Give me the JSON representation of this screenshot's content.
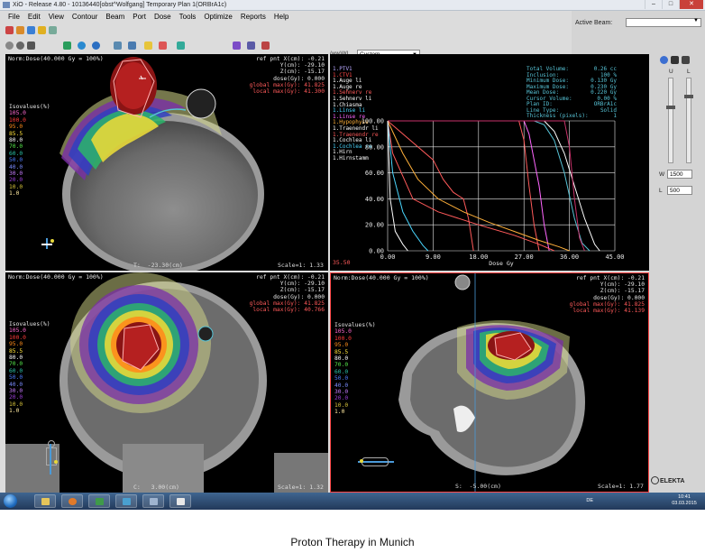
{
  "window": {
    "title": "XiO - Release 4.80 - 10136440[obst^Wolfgang] Temporary Plan 1(ORBrA1c)",
    "controls": {
      "minimize": "–",
      "maximize": "□",
      "close": "✕"
    }
  },
  "menu": [
    "File",
    "Edit",
    "View",
    "Contour",
    "Beam",
    "Port",
    "Dose",
    "Tools",
    "Optimize",
    "Reports",
    "Help"
  ],
  "toolbar": {
    "wl_label": "(ww)WL",
    "wl_preset": "Custom",
    "icons": [
      "zoom-icon",
      "pan-icon",
      "window-level-icon",
      "contour-icon",
      "grid-icon",
      "dose-icon",
      "beam-icon",
      "sphere-icon",
      "sphere-icon",
      "ruler-icon",
      "flag-icon",
      "undo-icon"
    ]
  },
  "right_pane": {
    "active_beam_label": "Active Beam:",
    "active_beam_value": "",
    "slider_u_label": "U",
    "slider_l_label": "L",
    "w_label": "W",
    "w_value": "1500",
    "l_label": "L",
    "l_value": "500",
    "brand": "ELEKTA"
  },
  "views": {
    "transverse": {
      "norm": "Norm:Dose(40.000 Gy = 100%)",
      "ref_labels": [
        "ref pnt X(cm):",
        "Y(cm):",
        "Z(cm):",
        "dose(Gy):",
        "global max(Gy):",
        "local max(Gy):"
      ],
      "ref_values": [
        "-0.21",
        "-29.10",
        "-15.17",
        "0.000",
        "41.825",
        "41.300"
      ],
      "slice": "T:  -23.30(cm)",
      "scale": "Scale=1: 1.33"
    },
    "coronal": {
      "norm": "Norm:Dose(40.000 Gy = 100%)",
      "ref_labels": [
        "ref pnt X(cm):",
        "Y(cm):",
        "Z(cm):",
        "dose(Gy):",
        "global max(Gy):",
        "local max(Gy):"
      ],
      "ref_values": [
        "-0.21",
        "-29.10",
        "-15.17",
        "0.000",
        "41.825",
        "40.766"
      ],
      "slice": "C:   3.00(cm)",
      "scale": "Scale=1: 1.32"
    },
    "sagittal": {
      "norm": "Norm:Dose(40.000 Gy = 100%)",
      "ref_labels": [
        "ref pnt X(cm):",
        "Y(cm):",
        "Z(cm):",
        "dose(Gy):",
        "global max(Gy):",
        "local max(Gy):"
      ],
      "ref_values": [
        "-0.21",
        "-29.10",
        "-15.17",
        "0.000",
        "41.825",
        "41.139"
      ],
      "slice": "S:  -5.00(cm)",
      "scale": "Scale=1: 1.77"
    }
  },
  "isovalues": {
    "title": "Isovalues(%)",
    "levels": [
      {
        "v": "105.0",
        "c": "#ff6ad1"
      },
      {
        "v": "100.0",
        "c": "#ff3b3b"
      },
      {
        "v": "95.0",
        "c": "#ff8c1a"
      },
      {
        "v": "85.5",
        "c": "#ffe23a"
      },
      {
        "v": "80.0",
        "c": "#ffffff"
      },
      {
        "v": "70.0",
        "c": "#55e84a"
      },
      {
        "v": "60.0",
        "c": "#2bc3a8"
      },
      {
        "v": "50.0",
        "c": "#4c7dff"
      },
      {
        "v": "40.0",
        "c": "#7a8cff"
      },
      {
        "v": "30.0",
        "c": "#c77dff"
      },
      {
        "v": "20.0",
        "c": "#9b3fd9"
      },
      {
        "v": "10.0",
        "c": "#d6c23a"
      },
      {
        "v": "1.0",
        "c": "#ffe9a0"
      }
    ]
  },
  "dvh": {
    "structures": [
      {
        "name": "1.PTV1",
        "c": "#b8a8ff"
      },
      {
        "name": "1.CTV1",
        "c": "#ff4a4a"
      },
      {
        "name": "1.Auge li",
        "c": "#ffffff"
      },
      {
        "name": "1.Auge re",
        "c": "#ffffff"
      },
      {
        "name": "1.Sehnerv re",
        "c": "#ff5a5a"
      },
      {
        "name": "1.Sehnerv li",
        "c": "#ffffff"
      },
      {
        "name": "1.Chiasma",
        "c": "#ffffff"
      },
      {
        "name": "1.Linse li",
        "c": "#4ad7ff"
      },
      {
        "name": "1.Linse re",
        "c": "#ff66ff"
      },
      {
        "name": "1.Hypophyse",
        "c": "#ffb03a"
      },
      {
        "name": "1.Traenendr li",
        "c": "#ffffff"
      },
      {
        "name": "1.Traenendr re",
        "c": "#ff5a5a"
      },
      {
        "name": "1.Cochlea li",
        "c": "#ffffff"
      },
      {
        "name": "1.Cochlea re",
        "c": "#4ad7ff"
      },
      {
        "name": "1.Hirn",
        "c": "#ffffff"
      },
      {
        "name": "1.Hirnstamm",
        "c": "#ffffff"
      }
    ],
    "info": [
      {
        "k": "Total Volume:",
        "v": "0.26 cc"
      },
      {
        "k": "Inclusion:",
        "v": "100 %"
      },
      {
        "k": "Minimum Dose:",
        "v": "0.130 Gy"
      },
      {
        "k": "Maximum Dose:",
        "v": "0.230 Gy"
      },
      {
        "k": "Mean Dose:",
        "v": "0.220 Gy"
      },
      {
        "k": "Cursor Volume:",
        "v": "0.00 %"
      },
      {
        "k": "Plan ID:",
        "v": "ORBrA1c"
      },
      {
        "k": "Line Type:",
        "v": "Solid"
      },
      {
        "k": "Thickness (pixels):",
        "v": "1"
      }
    ],
    "y_ticks": [
      "100.00",
      "80.00",
      "60.00",
      "40.00",
      "20.00",
      "0.00"
    ],
    "x_ticks": [
      "0.00",
      "9.00",
      "18.00",
      "27.00",
      "36.00",
      "45.00"
    ],
    "x_label": "Dose Gy",
    "cursor": "35.50"
  },
  "chart_data": {
    "type": "line",
    "xlabel": "Dose Gy",
    "ylabel": "",
    "xlim": [
      0,
      45
    ],
    "ylim": [
      0,
      100
    ],
    "grid": true,
    "series": [
      {
        "color": "#57c3d6",
        "points": [
          [
            0,
            100
          ],
          [
            29,
            100
          ],
          [
            31,
            97
          ],
          [
            33,
            85
          ],
          [
            35,
            60
          ],
          [
            37,
            25
          ],
          [
            38.5,
            6
          ],
          [
            40,
            0
          ]
        ]
      },
      {
        "color": "#ffffff",
        "points": [
          [
            0,
            100
          ],
          [
            31,
            100
          ],
          [
            33,
            92
          ],
          [
            35,
            75
          ],
          [
            37,
            50
          ],
          [
            39,
            25
          ],
          [
            41,
            5
          ],
          [
            42,
            0
          ]
        ]
      },
      {
        "color": "#ff66ff",
        "points": [
          [
            0,
            100
          ],
          [
            27,
            100
          ],
          [
            28,
            90
          ],
          [
            29,
            70
          ],
          [
            30,
            50
          ],
          [
            31,
            20
          ],
          [
            32,
            0
          ]
        ]
      },
      {
        "color": "#ff5a5a",
        "points": [
          [
            0,
            100
          ],
          [
            26,
            100
          ],
          [
            27,
            85
          ],
          [
            28,
            50
          ],
          [
            29,
            20
          ],
          [
            30,
            0
          ]
        ]
      },
      {
        "color": "#c8326a",
        "points": [
          [
            0,
            100
          ],
          [
            35,
            100
          ],
          [
            36,
            80
          ],
          [
            37,
            40
          ],
          [
            38,
            10
          ],
          [
            39,
            0
          ]
        ]
      },
      {
        "color": "#ff5a5a",
        "points": [
          [
            0,
            100
          ],
          [
            9,
            70
          ],
          [
            11,
            55
          ],
          [
            13,
            45
          ],
          [
            15,
            40
          ],
          [
            16,
            25
          ],
          [
            17,
            0
          ]
        ]
      },
      {
        "color": "#ffb03a",
        "points": [
          [
            0,
            100
          ],
          [
            3,
            75
          ],
          [
            6,
            55
          ],
          [
            10,
            40
          ],
          [
            15,
            30
          ],
          [
            20,
            22
          ],
          [
            25,
            15
          ],
          [
            30,
            8
          ],
          [
            34,
            3
          ],
          [
            36,
            0
          ]
        ]
      },
      {
        "color": "#ff5a5a",
        "points": [
          [
            0,
            100
          ],
          [
            1,
            75
          ],
          [
            5,
            40
          ],
          [
            10,
            30
          ],
          [
            18,
            20
          ],
          [
            25,
            12
          ],
          [
            30,
            5
          ],
          [
            33,
            0
          ]
        ]
      },
      {
        "color": "#4ad7ff",
        "points": [
          [
            0,
            100
          ],
          [
            1,
            60
          ],
          [
            3,
            30
          ],
          [
            5,
            15
          ],
          [
            7,
            4
          ],
          [
            8,
            0
          ]
        ]
      },
      {
        "color": "#ffffff",
        "points": [
          [
            0,
            100
          ],
          [
            0.5,
            40
          ],
          [
            1.5,
            15
          ],
          [
            3,
            5
          ],
          [
            4,
            0
          ]
        ]
      }
    ]
  },
  "taskbar": {
    "lang": "DE",
    "time": "10:41",
    "date": "03.03.2015"
  },
  "caption": "Proton Therapy in Munich"
}
